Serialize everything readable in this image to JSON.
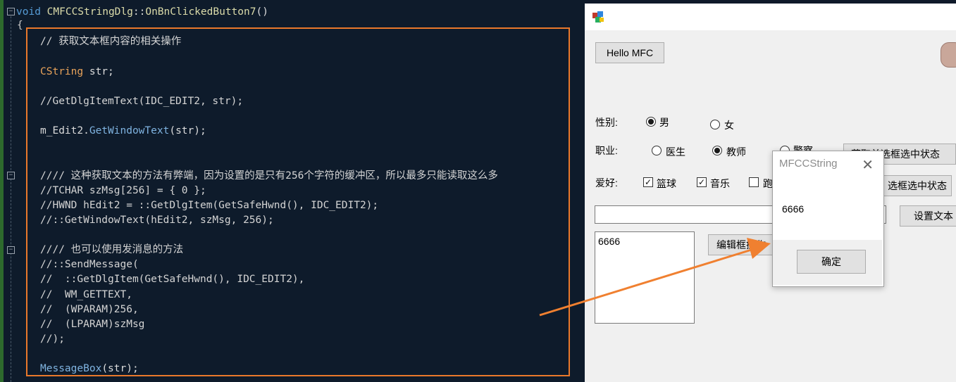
{
  "editor": {
    "signature": {
      "kw": "void",
      "cls": "CMFCCStringDlg",
      "sep": "::",
      "fn": "OnBnClickedButton7",
      "args": "()"
    },
    "open_brace": "{",
    "lines": [
      {
        "text": "// 获取文本框内容的相关操作",
        "style": "cm-grey"
      },
      {
        "text": "CString str;",
        "style": "type"
      },
      {
        "text": "//GetDlgItemText(IDC_EDIT2, str);",
        "style": "cm-grey"
      },
      {
        "text": "m_Edit2.GetWindowText(str);",
        "style": "mix"
      },
      {
        "text": "//// 这种获取文本的方法有弊端，因为设置的是只有256个字符的缓冲区，所以最多只能读取这么多",
        "style": "cm-grey"
      },
      {
        "text": "//TCHAR szMsg[256] = { 0 };",
        "style": "cm-grey"
      },
      {
        "text": "//HWND hEdit2 = ::GetDlgItem(GetSafeHwnd(), IDC_EDIT2);",
        "style": "cm-grey"
      },
      {
        "text": "//::GetWindowText(hEdit2, szMsg, 256);",
        "style": "cm-grey"
      },
      {
        "text": "//// 也可以使用发消息的方法",
        "style": "cm-grey"
      },
      {
        "text": "//::SendMessage(",
        "style": "cm-grey"
      },
      {
        "text": "//  ::GetDlgItem(GetSafeHwnd(), IDC_EDIT2),",
        "style": "cm-grey"
      },
      {
        "text": "//  WM_GETTEXT,",
        "style": "cm-grey"
      },
      {
        "text": "//  (WPARAM)256,",
        "style": "cm-grey"
      },
      {
        "text": "//  (LPARAM)szMsg",
        "style": "cm-grey"
      },
      {
        "text": "//);",
        "style": "cm-grey"
      },
      {
        "text": "MessageBox(str);",
        "style": "mb"
      }
    ],
    "mix_parts": {
      "obj": "m_Edit2.",
      "call": "GetWindowText",
      "rest": "(str);"
    },
    "mb_parts": {
      "call": "MessageBox",
      "rest": "(str);"
    }
  },
  "dialog": {
    "hello_button": "Hello MFC",
    "gender_label": "性别:",
    "gender_options": [
      "男",
      "女"
    ],
    "gender_selected": "男",
    "job_label": "职业:",
    "job_options": [
      "医生",
      "教师",
      "警察"
    ],
    "job_selected": "教师",
    "hobby_label": "爱好:",
    "hobby_options": [
      "篮球",
      "音乐",
      "跑"
    ],
    "hobby_checked": [
      "篮球",
      "音乐"
    ],
    "radio_state_button": "获取单选框选中状态",
    "check_state_button": "选框选中状态",
    "set_text_button": "设置文本",
    "edit_op_button": "编辑框操作",
    "multiline_value": "6666",
    "single_edit_value": ""
  },
  "message_box": {
    "title": "MFCCString",
    "close_glyph": "✕",
    "text": "6666",
    "ok_button": "确定"
  },
  "colors": {
    "highlight_box": "#e9782b",
    "arrow": "#f08030",
    "editor_bg": "#0e1b2b",
    "dialog_bg": "#f0f0f0"
  }
}
